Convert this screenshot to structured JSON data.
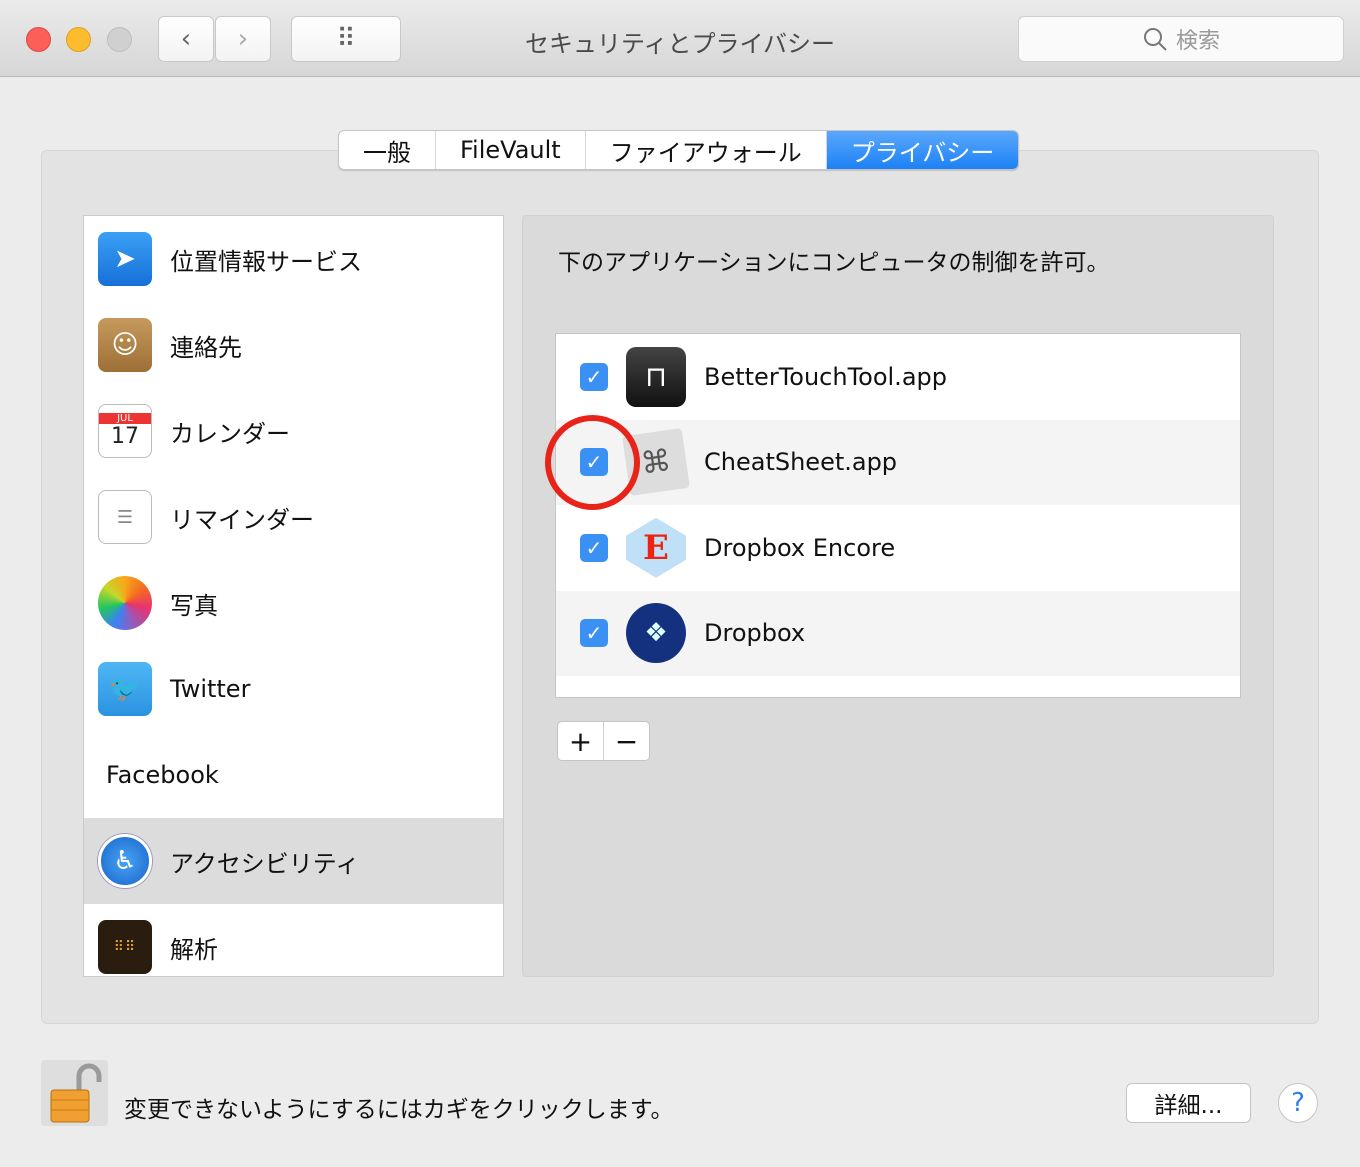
{
  "window": {
    "title": "セキュリティとプライバシー",
    "search_placeholder": "検索",
    "nav_back": "‹",
    "nav_forward": "›",
    "grid": "⠿"
  },
  "tabs": [
    {
      "label": "一般"
    },
    {
      "label": "FileVault"
    },
    {
      "label": "ファイアウォール"
    },
    {
      "label": "プライバシー",
      "active": true
    }
  ],
  "categories": [
    {
      "label": "位置情報サービス",
      "icon": "location-arrow-icon"
    },
    {
      "label": "連絡先",
      "icon": "contacts-book-icon"
    },
    {
      "label": "カレンダー",
      "icon": "calendar-icon",
      "month": "JUL",
      "day": "17"
    },
    {
      "label": "リマインダー",
      "icon": "reminders-icon"
    },
    {
      "label": "写真",
      "icon": "photos-icon"
    },
    {
      "label": "Twitter",
      "icon": "twitter-bird-icon"
    },
    {
      "label": "Facebook"
    },
    {
      "label": "アクセシビリティ",
      "icon": "accessibility-icon",
      "selected": true
    },
    {
      "label": "解析",
      "icon": "analytics-icon"
    }
  ],
  "main": {
    "description": "下のアプリケーションにコンピュータの制御を許可。",
    "apps": [
      {
        "name": "BetterTouchTool.app",
        "checked": true
      },
      {
        "name": "CheatSheet.app",
        "checked": true,
        "highlighted": true
      },
      {
        "name": "Dropbox Encore",
        "checked": true
      },
      {
        "name": "Dropbox",
        "checked": true
      }
    ],
    "add": "+",
    "remove": "−"
  },
  "footer": {
    "lock_text": "変更できないようにするにはカギをクリックします。",
    "details": "詳細...",
    "help": "?"
  },
  "colors": {
    "accent": "#1d82f6",
    "highlight_ring": "#e8241a"
  }
}
